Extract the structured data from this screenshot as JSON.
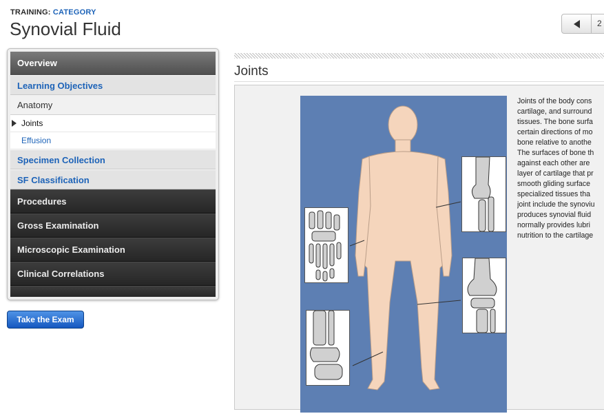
{
  "header": {
    "crumb_prefix": "TRAINING:",
    "crumb_category": "CATEGORY",
    "title": "Synovial Fluid",
    "page_number": "2"
  },
  "nav": {
    "overview": "Overview",
    "learning_objectives": "Learning Objectives",
    "anatomy": "Anatomy",
    "joints": "Joints",
    "effusion": "Effusion",
    "specimen_collection": "Specimen Collection",
    "sf_classification": "SF Classification",
    "procedures": "Procedures",
    "gross_examination": "Gross Examination",
    "microscopic_examination": "Microscopic Examination",
    "clinical_correlations": "Clinical Correlations"
  },
  "exam_button": "Take the Exam",
  "content": {
    "section_title": "Joints",
    "lines": [
      "Joints of the body cons",
      "cartilage, and surround",
      "tissues. The bone surfa",
      "certain directions of mo",
      "bone relative to anothe",
      "The surfaces of bone th",
      "against each other are",
      "layer of cartilage that pr",
      "smooth gliding surface",
      "specialized tissues tha",
      "joint include the synoviu",
      "produces synovial fluid",
      "normally provides lubri",
      "nutrition to the cartilage"
    ]
  },
  "colors": {
    "figure_background": "#5d7fb3",
    "skin": "#f5d5bc",
    "link_blue": "#1d63b8"
  }
}
